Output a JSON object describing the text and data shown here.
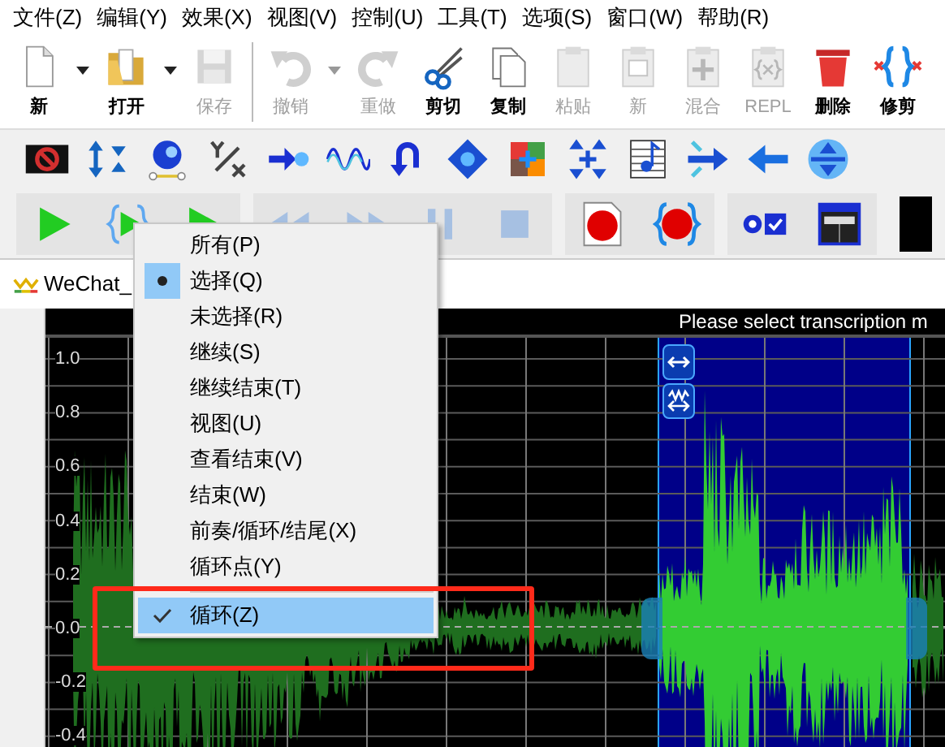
{
  "menu_bar": [
    "文件(Z)",
    "编辑(Y)",
    "效果(X)",
    "视图(V)",
    "控制(U)",
    "工具(T)",
    "选项(S)",
    "窗口(W)",
    "帮助(R)"
  ],
  "toolbar": [
    {
      "label": "新",
      "disabled": false,
      "has_dropdown": true
    },
    {
      "label": "打开",
      "disabled": false,
      "has_dropdown": true
    },
    {
      "label": "保存",
      "disabled": true,
      "has_dropdown": false
    },
    {
      "label": "撤销",
      "disabled": true,
      "has_dropdown": true
    },
    {
      "label": "重做",
      "disabled": true,
      "has_dropdown": false
    },
    {
      "label": "剪切",
      "disabled": false,
      "has_dropdown": false
    },
    {
      "label": "复制",
      "disabled": false,
      "has_dropdown": false
    },
    {
      "label": "粘贴",
      "disabled": true,
      "has_dropdown": false
    },
    {
      "label": "新",
      "disabled": true,
      "has_dropdown": false
    },
    {
      "label": "混合",
      "disabled": true,
      "has_dropdown": false
    },
    {
      "label": "REPL",
      "disabled": true,
      "has_dropdown": false
    },
    {
      "label": "删除",
      "disabled": false,
      "has_dropdown": false
    },
    {
      "label": "修剪",
      "disabled": false,
      "has_dropdown": false
    }
  ],
  "transport": [
    {
      "disabled": false
    },
    {
      "disabled": false
    },
    {
      "disabled": false
    },
    {
      "disabled": true
    },
    {
      "disabled": true
    },
    {
      "disabled": true
    },
    {
      "disabled": true
    },
    {
      "disabled": false
    },
    {
      "disabled": false
    },
    {
      "disabled": false
    },
    {
      "disabled": false
    }
  ],
  "document_tab": {
    "title": "WeChat_"
  },
  "waveform": {
    "header": "Please select transcription m",
    "y_axis_labels": [
      "1.0",
      "0.8",
      "0.6",
      "0.4",
      "0.2",
      "0.0",
      "-0.2",
      "-0.4"
    ]
  },
  "play_menu": {
    "items": [
      {
        "kind": "radio",
        "label": "所有(P)",
        "checked": false,
        "selected": false
      },
      {
        "kind": "radio",
        "label": "选择(Q)",
        "checked": true,
        "selected": false
      },
      {
        "kind": "radio",
        "label": "未选择(R)",
        "checked": false,
        "selected": false
      },
      {
        "kind": "radio",
        "label": "继续(S)",
        "checked": false,
        "selected": false
      },
      {
        "kind": "radio",
        "label": "继续结束(T)",
        "checked": false,
        "selected": false
      },
      {
        "kind": "radio",
        "label": "视图(U)",
        "checked": false,
        "selected": false
      },
      {
        "kind": "radio",
        "label": "查看结束(V)",
        "checked": false,
        "selected": false
      },
      {
        "kind": "radio",
        "label": "结束(W)",
        "checked": false,
        "selected": false
      },
      {
        "kind": "radio",
        "label": "前奏/循环/结尾(X)",
        "checked": false,
        "selected": false
      },
      {
        "kind": "radio",
        "label": "循环点(Y)",
        "checked": false,
        "selected": false
      },
      {
        "kind": "separator"
      },
      {
        "kind": "check",
        "label": "循环(Z)",
        "checked": true,
        "selected": true
      }
    ]
  }
}
